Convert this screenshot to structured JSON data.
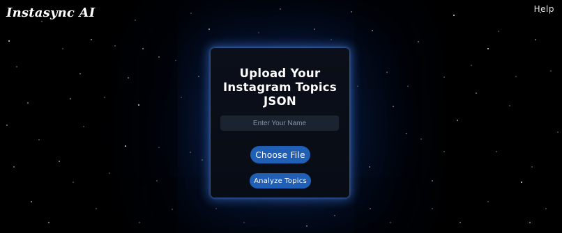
{
  "header": {
    "logo_text": "Instasync AI",
    "help_label": "Help"
  },
  "upload_card": {
    "title_lines": [
      "Upload Your",
      "Instagram Topics",
      "JSON"
    ],
    "name_input": {
      "value": "",
      "placeholder": "Enter Your Name"
    },
    "choose_file_label": "Choose File",
    "analyze_label": "Analyze Topics"
  },
  "colors": {
    "background": "#000000",
    "card_background": "#0a0f19",
    "card_glow": "#468cff",
    "button": "#1f5fb6",
    "input_background": "#1b2330",
    "text": "#ffffff"
  }
}
